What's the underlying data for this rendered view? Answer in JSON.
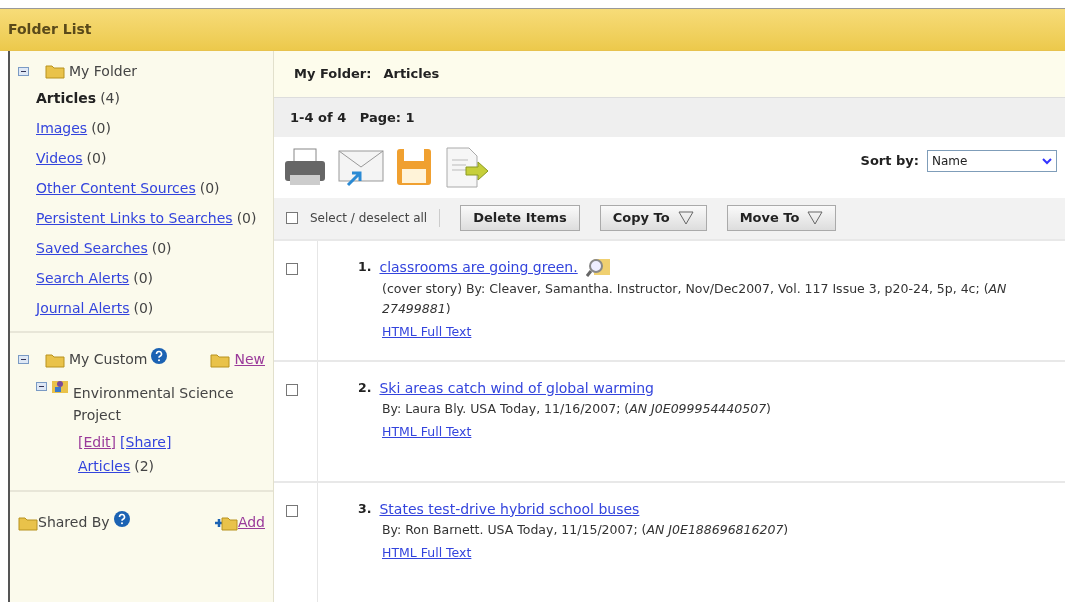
{
  "header": {
    "title": "Folder List"
  },
  "sidebar": {
    "my_folder": {
      "label": "My Folder",
      "expanded": true,
      "items": [
        {
          "label": "Articles",
          "count": "(4)",
          "selected": true
        },
        {
          "label": "Images",
          "count": "(0)",
          "selected": false
        },
        {
          "label": "Videos",
          "count": "(0)",
          "selected": false
        },
        {
          "label": "Other Content Sources",
          "count": "(0)",
          "selected": false
        },
        {
          "label": "Persistent Links to Searches",
          "count": "(0)",
          "selected": false
        },
        {
          "label": "Saved Searches",
          "count": "(0)",
          "selected": false
        },
        {
          "label": "Search Alerts",
          "count": "(0)",
          "selected": false
        },
        {
          "label": "Journal Alerts",
          "count": "(0)",
          "selected": false
        }
      ]
    },
    "my_custom": {
      "label": "My Custom",
      "expanded": true,
      "new_link": "New",
      "project": {
        "label": "Environmental Science Project",
        "expanded": true,
        "edit_link": "[Edit]",
        "share_link": "[Share]",
        "items": [
          {
            "label": "Articles",
            "count": "(2)"
          }
        ]
      }
    },
    "shared_by": {
      "label": "Shared By",
      "add_link": "Add"
    }
  },
  "main": {
    "breadcrumb": {
      "folder": "My Folder:",
      "current": "Articles"
    },
    "paging": "1-4 of 4   Page: 1",
    "sort": {
      "label": "Sort by:",
      "value": "Name"
    },
    "select_all": {
      "label": "Select / deselect all",
      "checked": false
    },
    "buttons": [
      {
        "label": "Delete Items",
        "kind": "plain"
      },
      {
        "label": "Copy To",
        "kind": "menu"
      },
      {
        "label": "Move To",
        "kind": "menu"
      }
    ],
    "results": [
      {
        "number": "1.",
        "title": "classrooms are going green.",
        "checked": false,
        "has_preview": true,
        "citation": "(cover story) By: Cleaver, Samantha. Instructor, Nov/Dec2007, Vol. 117 Issue 3, p20-24, 5p, 4c; (*AN 27499881*)",
        "link": "HTML Full Text"
      },
      {
        "number": "2.",
        "title": "Ski areas catch wind of global warming",
        "checked": false,
        "has_preview": false,
        "citation": "By: Laura Bly. USA Today, 11/16/2007; (*AN J0E099954440507*)",
        "link": "HTML Full Text"
      },
      {
        "number": "3.",
        "title": "States test-drive hybrid school buses",
        "checked": false,
        "has_preview": false,
        "citation": "By: Ron Barnett. USA Today, 11/15/2007; (*AN J0E188696816207*)",
        "link": "HTML Full Text"
      }
    ]
  }
}
